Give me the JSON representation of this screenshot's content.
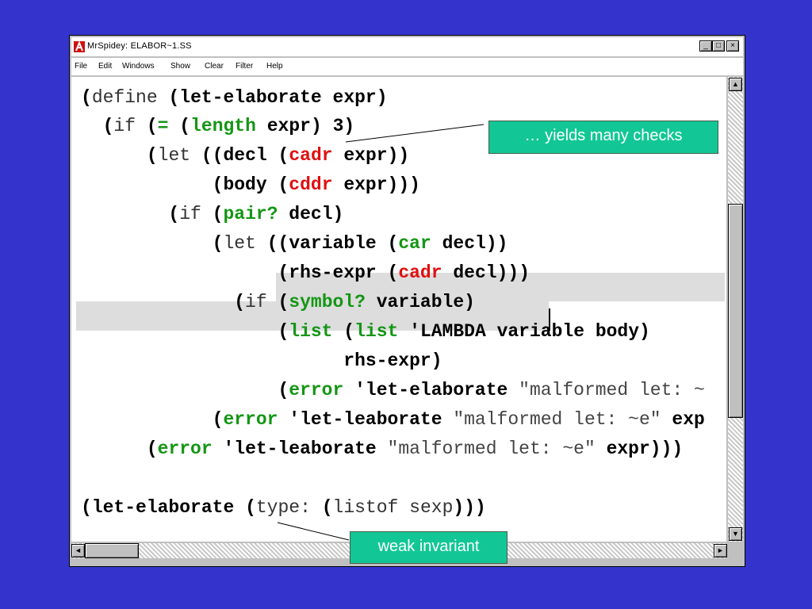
{
  "window": {
    "title": "MrSpidey: ELABOR~1.SS",
    "buttons": {
      "minimize": "_",
      "maximize": "□",
      "close": "×"
    }
  },
  "menu": {
    "items": [
      "File",
      "Edit",
      "Windows",
      "Show",
      "Clear",
      "Filter",
      "Help"
    ]
  },
  "code": {
    "lines": [
      "(define (let-elaborate expr)",
      "  (if (= (length expr) 3)",
      "      (let ((decl (cadr expr))",
      "            (body (cddr expr)))",
      "        (if (pair? decl)",
      "            (let ((variable (car decl))",
      "                  (rhs-expr (cadr decl)))",
      "              (if (symbol? variable)",
      "                  (list (list 'LAMBDA variable body)",
      "                        rhs-expr)",
      "                  (error 'let-elaborate \"malformed let: ~",
      "            (error 'let-leaborate \"malformed let: ~e\" exp",
      "      (error 'let-leaborate \"malformed let: ~e\" expr)))",
      "",
      "(let-elaborate (type: (listof sexp)))"
    ]
  },
  "callouts": {
    "checks": "… yields many checks",
    "weak": "weak invariant"
  },
  "scrollbars": {
    "up": "▲",
    "down": "▼",
    "left": "◄",
    "right": "►"
  },
  "colors": {
    "background": "#3434cc",
    "callout": "#12c795",
    "keyword_green": "#149614",
    "keyword_red": "#e01010"
  }
}
